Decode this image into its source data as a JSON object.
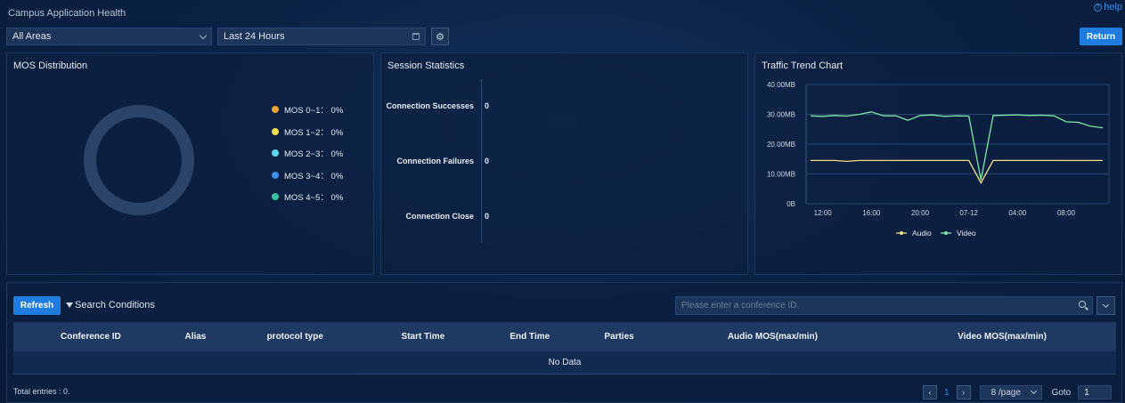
{
  "header": {
    "title": "Campus Application Health",
    "help_label": "help"
  },
  "toolbar": {
    "area_select": "All Areas",
    "time_range": "Last 24 Hours",
    "return_label": "Return"
  },
  "mos": {
    "title": "MOS Distribution",
    "items": [
      {
        "label": "MOS 0~1：  0%",
        "color": "#f0a232"
      },
      {
        "label": "MOS 1~2：  0%",
        "color": "#f5dc4a"
      },
      {
        "label": "MOS 2~3：  0%",
        "color": "#5fd6f0"
      },
      {
        "label": "MOS 3~4：  0%",
        "color": "#3d8df0"
      },
      {
        "label": "MOS 4~5：  0%",
        "color": "#36c49e"
      }
    ]
  },
  "session": {
    "title": "Session Statistics",
    "rows": [
      {
        "label": "Connection Successes",
        "value": "0"
      },
      {
        "label": "Connection Failures",
        "value": "0"
      },
      {
        "label": "Connection Close",
        "value": "0"
      }
    ]
  },
  "traffic": {
    "title": "Traffic Trend Chart",
    "legend": [
      "Audio",
      "Video"
    ],
    "colors": {
      "audio": "#f3e08a",
      "video": "#7ee8a8"
    }
  },
  "chart_data": {
    "type": "line",
    "title": "Traffic Trend Chart",
    "y_ticks": [
      "0B",
      "10.00MB",
      "20.00MB",
      "30.00MB",
      "40.00MB"
    ],
    "x_ticks": [
      "12:00",
      "16:00",
      "20:00",
      "07-12",
      "04:00",
      "08:00"
    ],
    "ylim": [
      0,
      40
    ],
    "y_unit": "MB",
    "grid": true,
    "legend_position": "bottom",
    "x": [
      0,
      1,
      2,
      3,
      4,
      5,
      6,
      7,
      8,
      9,
      10,
      11,
      12,
      13,
      14,
      15,
      16,
      17,
      18,
      19,
      20,
      21,
      22,
      23,
      24
    ],
    "x_tick_index": [
      1,
      5,
      9,
      13,
      17,
      21
    ],
    "series": [
      {
        "name": "Audio",
        "values": [
          14.5,
          14.5,
          14.5,
          14.2,
          14.5,
          14.5,
          14.5,
          14.5,
          14.5,
          14.5,
          14.5,
          14.5,
          14.5,
          14.5,
          7.0,
          14.5,
          14.5,
          14.5,
          14.5,
          14.5,
          14.5,
          14.5,
          14.5,
          14.5,
          14.5
        ]
      },
      {
        "name": "Video",
        "values": [
          29.5,
          29.3,
          29.6,
          29.4,
          30.0,
          30.8,
          29.5,
          29.5,
          28.0,
          29.6,
          29.8,
          29.3,
          29.5,
          29.4,
          8.0,
          29.6,
          29.7,
          29.8,
          29.6,
          29.7,
          29.5,
          27.5,
          27.3,
          26.0,
          25.5
        ]
      }
    ]
  },
  "records": {
    "refresh_label": "Refresh",
    "search_conditions_label": "Search Conditions",
    "search_placeholder": "Please enter a conference ID.",
    "columns": [
      "Conference ID",
      "Alias",
      "protocol type",
      "Start Time",
      "End Time",
      "Parties",
      "Audio MOS(max/min)",
      "Video MOS(max/min)"
    ],
    "empty_text": "No Data",
    "total_text": "Total entries : 0.",
    "pagination": {
      "current_page": "1",
      "page_size": "8 /page",
      "goto_label": "Goto",
      "goto_value": "1"
    }
  }
}
